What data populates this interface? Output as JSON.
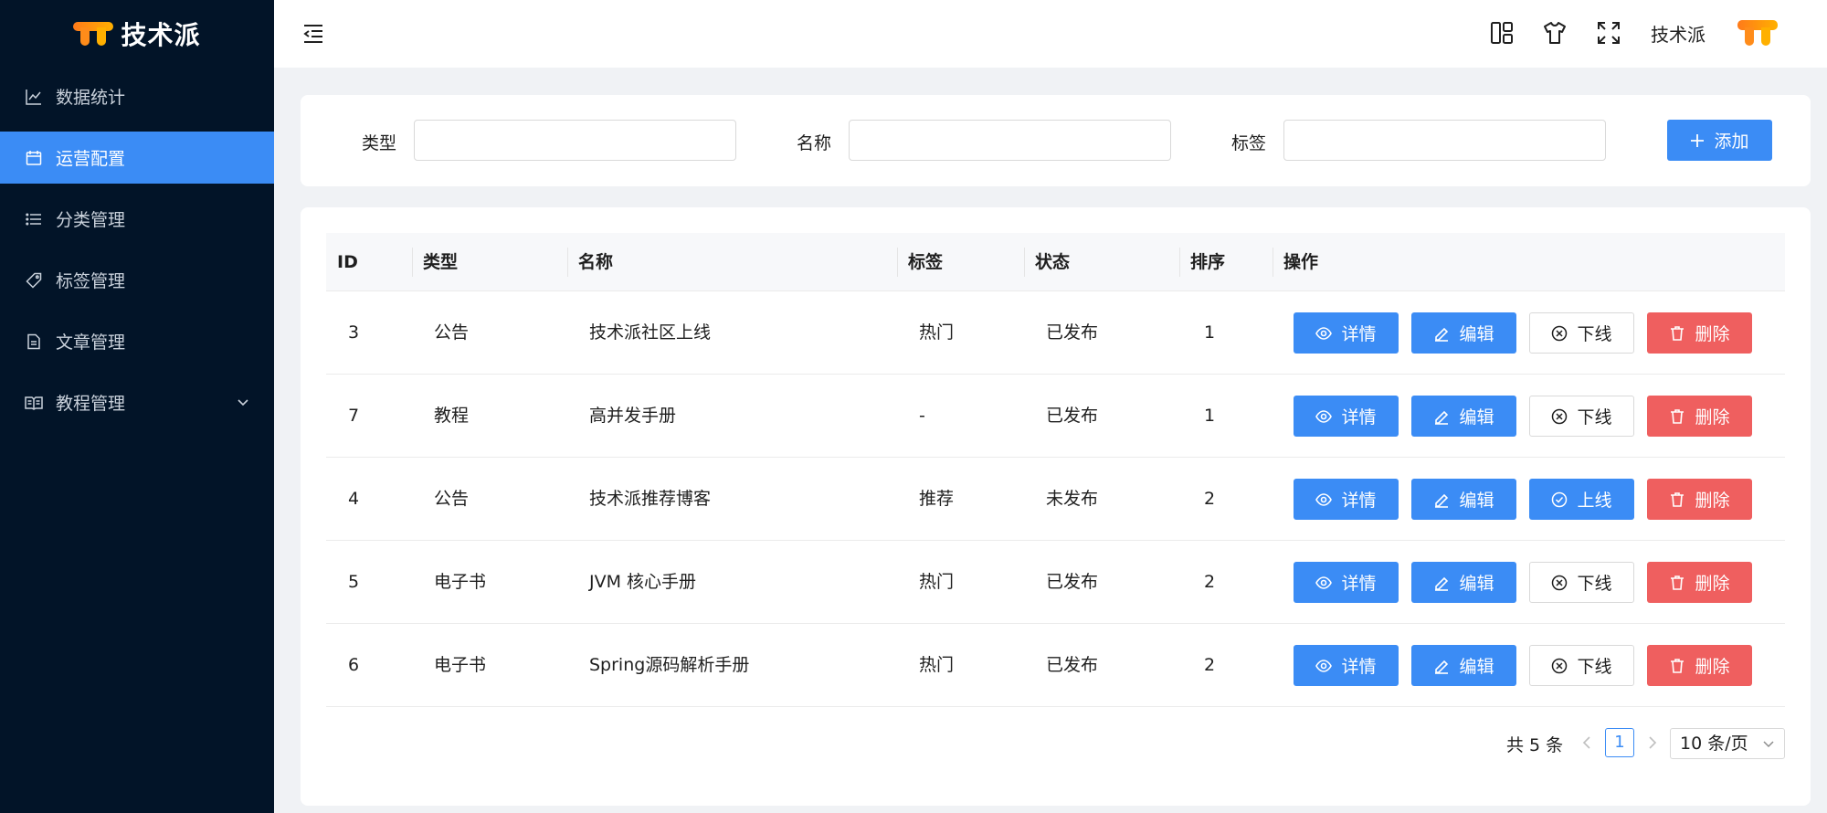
{
  "app": {
    "brand": "技术派"
  },
  "sidebar": {
    "items": [
      {
        "label": "数据统计",
        "icon": "line-chart-icon",
        "active": false
      },
      {
        "label": "运营配置",
        "icon": "calendar-icon",
        "active": true
      },
      {
        "label": "分类管理",
        "icon": "list-icon",
        "active": false
      },
      {
        "label": "标签管理",
        "icon": "tag-icon",
        "active": false
      },
      {
        "label": "文章管理",
        "icon": "file-text-icon",
        "active": false
      },
      {
        "label": "教程管理",
        "icon": "book-icon",
        "active": false,
        "expandable": true
      }
    ]
  },
  "header": {
    "user_name": "技术派",
    "icons": [
      "layout-icon",
      "shirt-icon",
      "fullscreen-icon"
    ]
  },
  "filter": {
    "type_label": "类型",
    "name_label": "名称",
    "tag_label": "标签",
    "type_value": "",
    "name_value": "",
    "tag_value": "",
    "add_label": "添加"
  },
  "table": {
    "columns": [
      "ID",
      "类型",
      "名称",
      "标签",
      "状态",
      "排序",
      "操作"
    ],
    "rows": [
      {
        "id": "3",
        "type": "公告",
        "name": "技术派社区上线",
        "tag": "热门",
        "status": "已发布",
        "sort": "1",
        "toggle": "下线"
      },
      {
        "id": "7",
        "type": "教程",
        "name": "高并发手册",
        "tag": "-",
        "status": "已发布",
        "sort": "1",
        "toggle": "下线"
      },
      {
        "id": "4",
        "type": "公告",
        "name": "技术派推荐博客",
        "tag": "推荐",
        "status": "未发布",
        "sort": "2",
        "toggle": "上线"
      },
      {
        "id": "5",
        "type": "电子书",
        "name": "JVM 核心手册",
        "tag": "热门",
        "status": "已发布",
        "sort": "2",
        "toggle": "下线"
      },
      {
        "id": "6",
        "type": "电子书",
        "name": "Spring源码解析手册",
        "tag": "热门",
        "status": "已发布",
        "sort": "2",
        "toggle": "下线"
      }
    ],
    "actions": {
      "detail": "详情",
      "edit": "编辑",
      "delete": "删除"
    }
  },
  "pagination": {
    "total_text": "共 5 条",
    "current_page": "1",
    "page_size": "10 条/页"
  },
  "colors": {
    "primary": "#3b8cf5",
    "danger": "#ef5f5f",
    "sidebar": "#021428"
  }
}
